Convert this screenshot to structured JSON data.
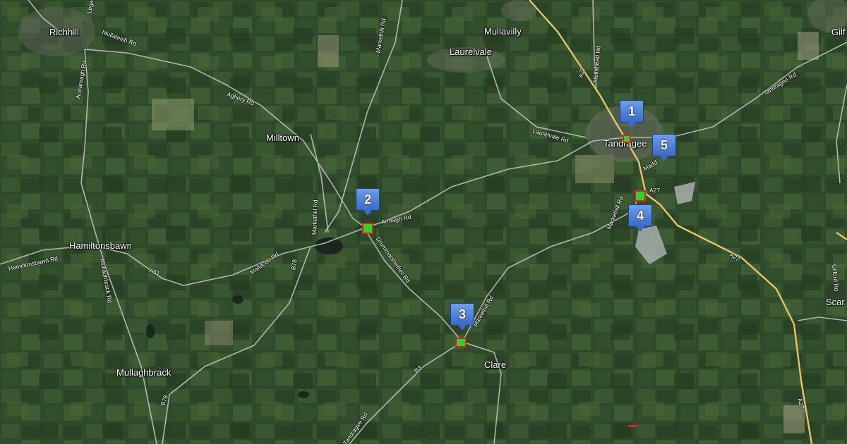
{
  "map": {
    "type": "satellite",
    "places": [
      {
        "id": "richhill",
        "name": "Richhill"
      },
      {
        "id": "mullavilly",
        "name": "Mullavilly"
      },
      {
        "id": "laurelvale",
        "name": "Laurelvale"
      },
      {
        "id": "tandragee",
        "name": "Tandragee"
      },
      {
        "id": "milltown",
        "name": "Milltown"
      },
      {
        "id": "hamiltonsbawn",
        "name": "Hamiltonsbawn"
      },
      {
        "id": "clare",
        "name": "Clare"
      },
      {
        "id": "mullaghbrack",
        "name": "Mullaghbrack"
      },
      {
        "id": "gilford",
        "name": "Gilf"
      },
      {
        "id": "scarva",
        "name": "Scar"
      }
    ],
    "roads": [
      {
        "id": "mullaleish-rd",
        "name": "Mullaleish Rd"
      },
      {
        "id": "legacorry-rd",
        "name": "Lega"
      },
      {
        "id": "annareagh-rd",
        "name": "Annareagh Rd"
      },
      {
        "id": "markethill-rd-north",
        "name": "Markethill Rd"
      },
      {
        "id": "aghory-rd",
        "name": "Aghory Rd"
      },
      {
        "id": "a27-north",
        "name": "A27"
      },
      {
        "id": "mullahead-rd",
        "name": "Mullahead Rd"
      },
      {
        "id": "tandragee-rd-east",
        "name": "Tandragee Rd"
      },
      {
        "id": "laurelvale-rd",
        "name": "Laurelvale Rd"
      },
      {
        "id": "madden-rd",
        "name": "Madd"
      },
      {
        "id": "a27-mid",
        "name": "A27"
      },
      {
        "id": "markethill-rd-mid",
        "name": "Markethill Rd"
      },
      {
        "id": "markethill-rd-west",
        "name": "Markethill Rd"
      },
      {
        "id": "armagh-rd",
        "name": "Armagh Rd"
      },
      {
        "id": "mallacoo-rd",
        "name": "Mallacoo Rd"
      },
      {
        "id": "hamiltonsbawn-rd",
        "name": "Hamiltonsbawn Rd"
      },
      {
        "id": "a51",
        "name": "A51"
      },
      {
        "id": "mullaghbrack-rd",
        "name": "Mullaghbrack Rd"
      },
      {
        "id": "b78-mid",
        "name": "B78"
      },
      {
        "id": "drummanmether-rd",
        "name": "Drummanmether Rd"
      },
      {
        "id": "markethill-rd-south",
        "name": "Markethill Rd"
      },
      {
        "id": "a27-south",
        "name": "A27"
      },
      {
        "id": "gilford-rd",
        "name": "Gilford Rd"
      },
      {
        "id": "b3",
        "name": "B3"
      },
      {
        "id": "tandragee-rd-south",
        "name": "Tandragee Rd"
      },
      {
        "id": "b78-south",
        "name": "B78"
      },
      {
        "id": "a27-far-south",
        "name": "A27"
      }
    ],
    "markers": [
      {
        "number": "1",
        "location": "Tandragee"
      },
      {
        "number": "2",
        "location": "Armagh Rd"
      },
      {
        "number": "3",
        "location": "Clare"
      },
      {
        "number": "4",
        "location": "A27 south of Tandragee"
      },
      {
        "number": "5",
        "location": "Tandragee east"
      }
    ],
    "colors": {
      "marker_fill": "#4a7bd8",
      "site_fill": "#30d030",
      "site_border": "#d22222",
      "road_major": "#e6c46a",
      "road_minor": "#b8b8b8",
      "base_green": "#2f4a2a"
    }
  }
}
